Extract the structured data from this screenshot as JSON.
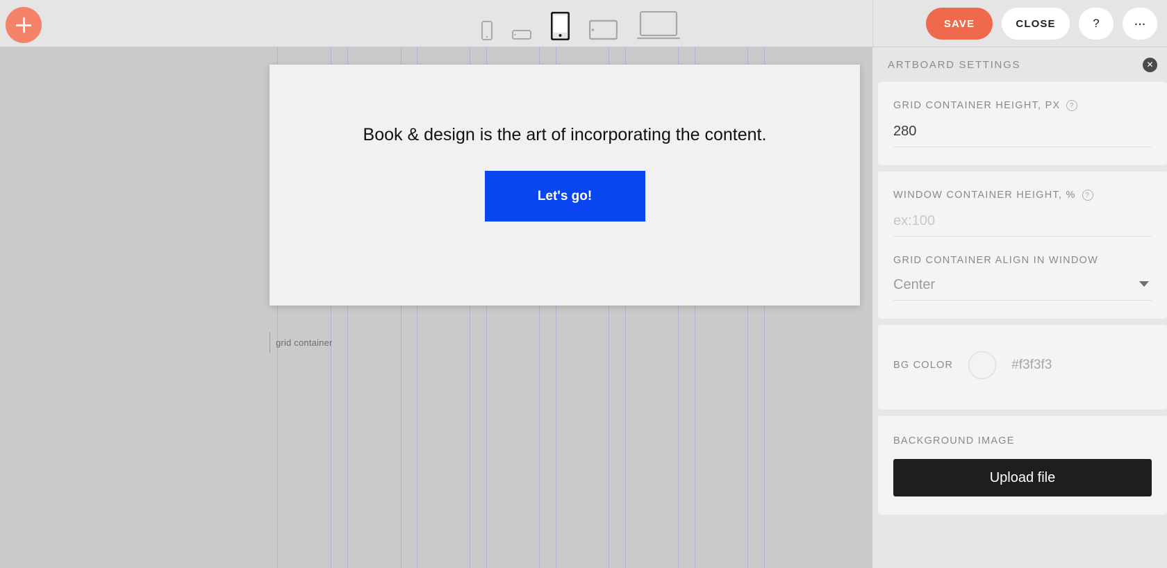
{
  "topbar": {
    "add_button_label": "+",
    "devices": [
      {
        "name": "phone-portrait",
        "label": "Phone portrait",
        "active": false
      },
      {
        "name": "phone-landscape",
        "label": "Phone landscape",
        "active": false
      },
      {
        "name": "tablet-portrait",
        "label": "Tablet portrait",
        "active": true
      },
      {
        "name": "tablet-landscape",
        "label": "Tablet landscape",
        "active": false
      },
      {
        "name": "desktop",
        "label": "Desktop",
        "active": false
      }
    ],
    "save_label": "SAVE",
    "close_label": "CLOSE",
    "help_label": "?",
    "more_label": "...",
    "save_color": "#ef6a4c",
    "add_color": "#f5836a"
  },
  "canvas": {
    "background_color": "#cacaca",
    "artboard": {
      "background_color": "#f1f1f1",
      "hero_title": "Book & design is the art of incorporating the content.",
      "cta_label": "Let's go!",
      "cta_color": "#0a46f0"
    },
    "grid_label": "grid container",
    "guide_color": "#a9a9d6",
    "guide_positions": [
      399,
      476,
      500,
      577,
      600,
      676,
      700,
      776,
      800,
      876,
      900,
      976,
      1000,
      1076,
      1100
    ]
  },
  "panel": {
    "title": "ARTBOARD SETTINGS",
    "close_label": "✕",
    "grid_height": {
      "label": "GRID CONTAINER HEIGHT, PX",
      "help": "?",
      "value": "280",
      "placeholder": ""
    },
    "window_height": {
      "label": "WINDOW CONTAINER HEIGHT, %",
      "help": "?",
      "value": "",
      "placeholder": "ex:100"
    },
    "align": {
      "label": "GRID CONTAINER ALIGN IN WINDOW",
      "value": "Center"
    },
    "bg_color": {
      "label": "BG COLOR",
      "hex": "#f3f3f3"
    },
    "background_image": {
      "label": "BACKGROUND IMAGE",
      "upload_label": "Upload file"
    }
  }
}
